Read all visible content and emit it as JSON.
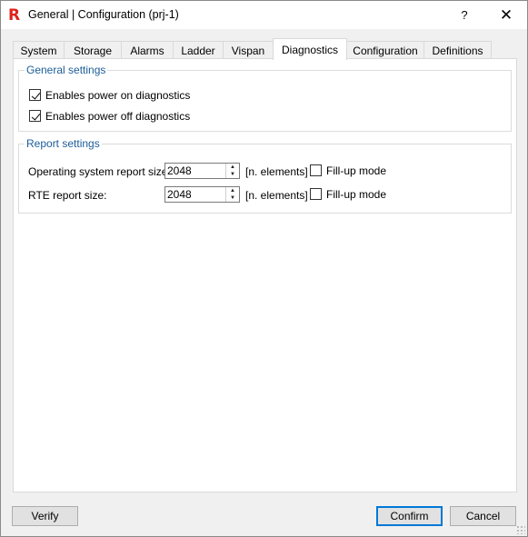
{
  "window": {
    "title": "General | Configuration (prj-1)",
    "app_icon_glyph": "R",
    "help_glyph": "?",
    "close_glyph": "✕"
  },
  "tabs": [
    {
      "label": "System"
    },
    {
      "label": "Storage"
    },
    {
      "label": "Alarms"
    },
    {
      "label": "Ladder"
    },
    {
      "label": "Vispan"
    },
    {
      "label": "Diagnostics",
      "active": true
    },
    {
      "label": "Configuration"
    },
    {
      "label": "Definitions"
    }
  ],
  "general_settings": {
    "title": "General settings",
    "power_on": {
      "label": "Enables power on diagnostics",
      "checked": true
    },
    "power_off": {
      "label": "Enables power off diagnostics",
      "checked": true
    }
  },
  "report_settings": {
    "title": "Report settings",
    "os_report": {
      "label": "Operating system report size:",
      "value": "2048",
      "unit": "[n. elements]",
      "fillup_label": "Fill-up mode",
      "fillup_checked": false
    },
    "rte_report": {
      "label": "RTE report size:",
      "value": "2048",
      "unit": "[n. elements]",
      "fillup_label": "Fill-up mode",
      "fillup_checked": false
    }
  },
  "buttons": {
    "verify": "Verify",
    "confirm": "Confirm",
    "cancel": "Cancel"
  },
  "colors": {
    "accent": "#1c5d99",
    "app_icon": "#e0201b",
    "focus_border": "#0078d7"
  }
}
